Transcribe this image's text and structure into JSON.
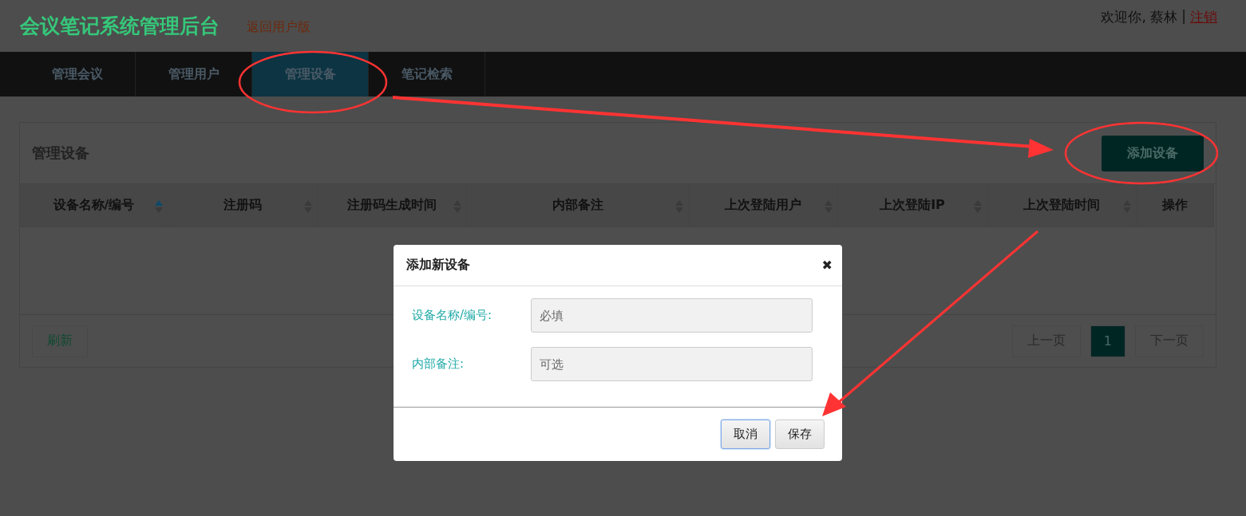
{
  "header": {
    "title": "会议笔记系统管理后台",
    "back_link": "返回用户版",
    "welcome": "欢迎你, 蔡林",
    "separator": "|",
    "logout": "注销"
  },
  "tabs": [
    {
      "label": "管理会议",
      "selected": false
    },
    {
      "label": "管理用户",
      "selected": false
    },
    {
      "label": "管理设备",
      "selected": true
    },
    {
      "label": "笔记检索",
      "selected": false
    }
  ],
  "panel": {
    "title": "管理设备",
    "add_button": "添加设备",
    "refresh_button": "刷新"
  },
  "table": {
    "columns": [
      {
        "label": "设备名称/编号",
        "sorted": true
      },
      {
        "label": "注册码",
        "sorted": false
      },
      {
        "label": "注册码生成时间",
        "sorted": false
      },
      {
        "label": "内部备注",
        "sorted": false
      },
      {
        "label": "上次登陆用户",
        "sorted": false
      },
      {
        "label": "上次登陆IP",
        "sorted": false
      },
      {
        "label": "上次登陆时间",
        "sorted": false
      },
      {
        "label": "操作"
      }
    ]
  },
  "pagination": {
    "prev": "上一页",
    "pages": [
      {
        "label": "1",
        "selected": true
      }
    ],
    "next": "下一页"
  },
  "dialog": {
    "title": "添加新设备",
    "close": "✖",
    "fields": [
      {
        "label": "设备名称/编号:",
        "placeholder": "必填"
      },
      {
        "label": "内部备注:",
        "placeholder": "可选"
      }
    ],
    "buttons": [
      {
        "label": "取消",
        "focused": true
      },
      {
        "label": "保存",
        "focused": false
      }
    ]
  }
}
